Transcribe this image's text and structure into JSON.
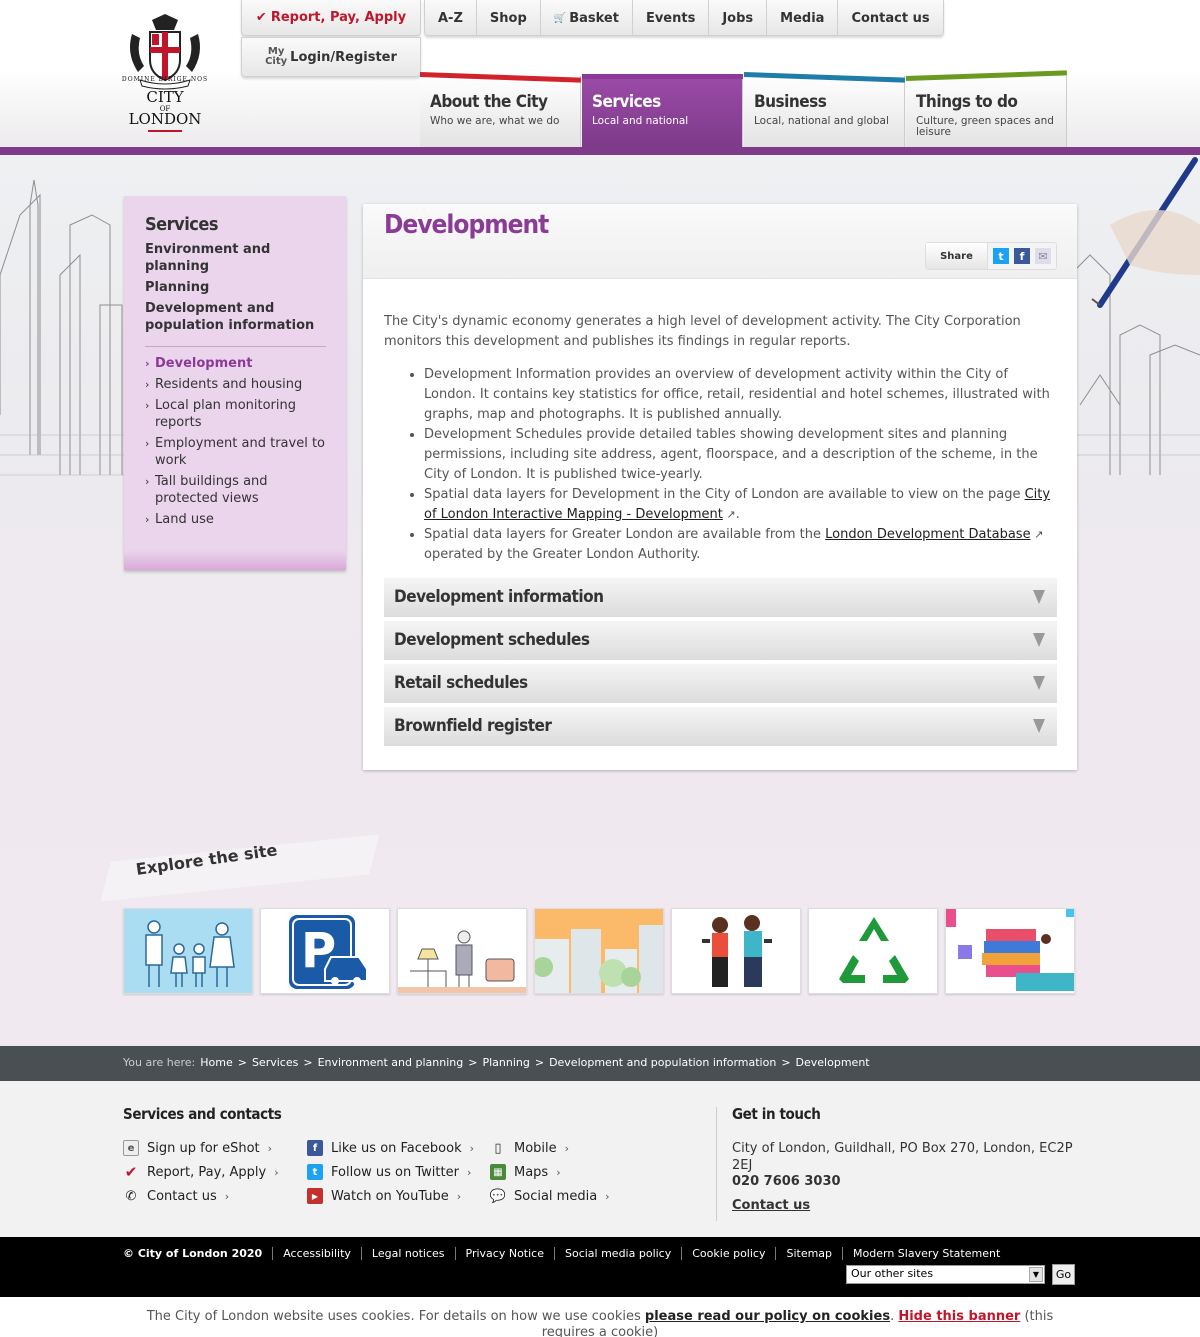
{
  "brand": {
    "city": "CITY",
    "of": "OF",
    "london": "LONDON",
    "motto": "DOMINE DIRIGE NOS"
  },
  "top_buttons": {
    "report_pay_apply": "Report, Pay, Apply",
    "login_my": "My",
    "login_city": "City",
    "login_label": "Login/Register"
  },
  "top_nav": [
    "A-Z",
    "Shop",
    "Basket",
    "Events",
    "Jobs",
    "Media",
    "Contact us"
  ],
  "main_nav": [
    {
      "title": "About the City",
      "sub": "Who we are, what we do",
      "color": "#d2232a"
    },
    {
      "title": "Services",
      "sub": "Local and national",
      "color": "#8b3a98"
    },
    {
      "title": "Business",
      "sub": "Local, national and global",
      "color": "#1f7ca8"
    },
    {
      "title": "Things to do",
      "sub": "Culture, green spaces and leisure",
      "color": "#6a9a1f"
    }
  ],
  "sidebar": {
    "heading": "Services",
    "level1": [
      "Environment and planning",
      "Planning",
      "Development and population information"
    ],
    "level2": [
      "Development",
      "Residents and housing",
      "Local plan monitoring reports",
      "Employment and travel to work",
      "Tall buildings and protected views",
      "Land use"
    ]
  },
  "content": {
    "title": "Development",
    "share_label": "Share",
    "intro": "The City's dynamic economy generates a high level of development activity. The City Corporation monitors this development and publishes its findings in regular reports.",
    "bullets": [
      {
        "text": "Development Information provides an overview of development activity within the City of London. It contains key statistics for office, retail, residential and hotel schemes, illustrated with graphs, map and photographs. It is published annually."
      },
      {
        "text": "Development Schedules provide detailed tables showing development sites and planning permissions, including site address, agent, floorspace, and a description of the scheme, in the City of London. It is published twice-yearly."
      },
      {
        "before": "Spatial data layers for Development in the City of London are available to view on the page ",
        "link": "City of London Interactive Mapping - Development",
        "after": "."
      },
      {
        "before": "Spatial data layers for Greater London are available from the ",
        "link": "London Development Database",
        "after": " operated by the Greater London Authority."
      }
    ],
    "accordions": [
      "Development information",
      "Development schedules",
      "Retail schedules",
      "Brownfield register"
    ]
  },
  "explore": {
    "title": "Explore the site"
  },
  "breadcrumb": {
    "label": "You are here:",
    "items": [
      "Home",
      "Services",
      "Environment and planning",
      "Planning",
      "Development and population information",
      "Development"
    ],
    "sep": ">"
  },
  "footer": {
    "services_heading": "Services and contacts",
    "col1": [
      "Sign up for eShot",
      "Report, Pay, Apply",
      "Contact us"
    ],
    "col2": [
      "Like us on Facebook",
      "Follow us on Twitter",
      "Watch on YouTube"
    ],
    "col3": [
      "Mobile",
      "Maps",
      "Social media"
    ],
    "touch_heading": "Get in touch",
    "address": "City of London, Guildhall, PO Box 270, London, EC2P 2EJ",
    "phone": "020 7606 3030",
    "contact": "Contact us"
  },
  "legal": {
    "links": [
      "© City of London 2020",
      "Accessibility",
      "Legal notices",
      "Privacy Notice",
      "Social media policy",
      "Cookie policy",
      "Sitemap",
      "Modern Slavery Statement"
    ],
    "select_value": "Our other sites",
    "go": "Go"
  },
  "cookie": {
    "text1": "The City of London website uses cookies. For details on how we use cookies ",
    "link": "please read our policy on cookies",
    "text2": ". ",
    "hide": "Hide this banner",
    "text3": " (this requires a cookie)"
  },
  "colors": {
    "purple": "#8b3a98",
    "red": "#c0162c"
  }
}
